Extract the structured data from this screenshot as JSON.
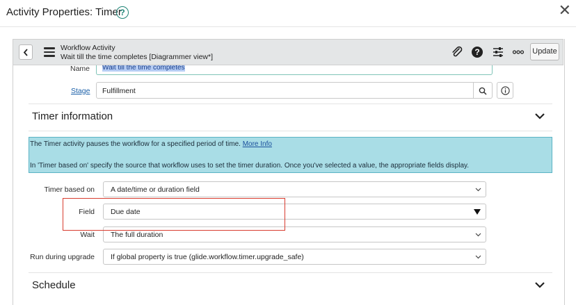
{
  "dialog": {
    "title": "Activity Properties: Timer",
    "help_symbol": "?",
    "close_symbol": "✕"
  },
  "toolbar": {
    "title_line1": "Workflow Activity",
    "title_line2": "Wait till the time completes [Diagrammer view*]",
    "update_label": "Update",
    "icons": [
      "back-chevron-icon",
      "hamburger-menu-icon",
      "paperclip-icon",
      "help-icon",
      "sliders-icon",
      "more-icon"
    ]
  },
  "form": {
    "name_label": "Name",
    "name_value": "Wait till the time completes",
    "stage_label": "Stage",
    "stage_value": "Fulfillment"
  },
  "timer_section": {
    "title": "Timer information",
    "info_text_1": "The Timer activity pauses the workflow for a specified period of time.",
    "info_link": "More Info",
    "info_text_2": "In 'Timer based on' specify the source that workflow uses to set the timer duration. Once you've selected a value, the appropriate fields display.",
    "rows": {
      "timer_based_on_label": "Timer based on",
      "timer_based_on_value": "A date/time or duration field",
      "field_label": "Field",
      "field_value": "Due date",
      "wait_label": "Wait",
      "wait_value": "The full duration",
      "run_upgrade_label": "Run during upgrade",
      "run_upgrade_value": "If global property is true (glide.workflow.timer.upgrade_safe)"
    }
  },
  "schedule_section": {
    "title": "Schedule"
  },
  "colors": {
    "accent": "#1f8476",
    "info_bg": "#a9dde6",
    "highlight": "#d83b2e",
    "link": "#1a5fa8"
  }
}
